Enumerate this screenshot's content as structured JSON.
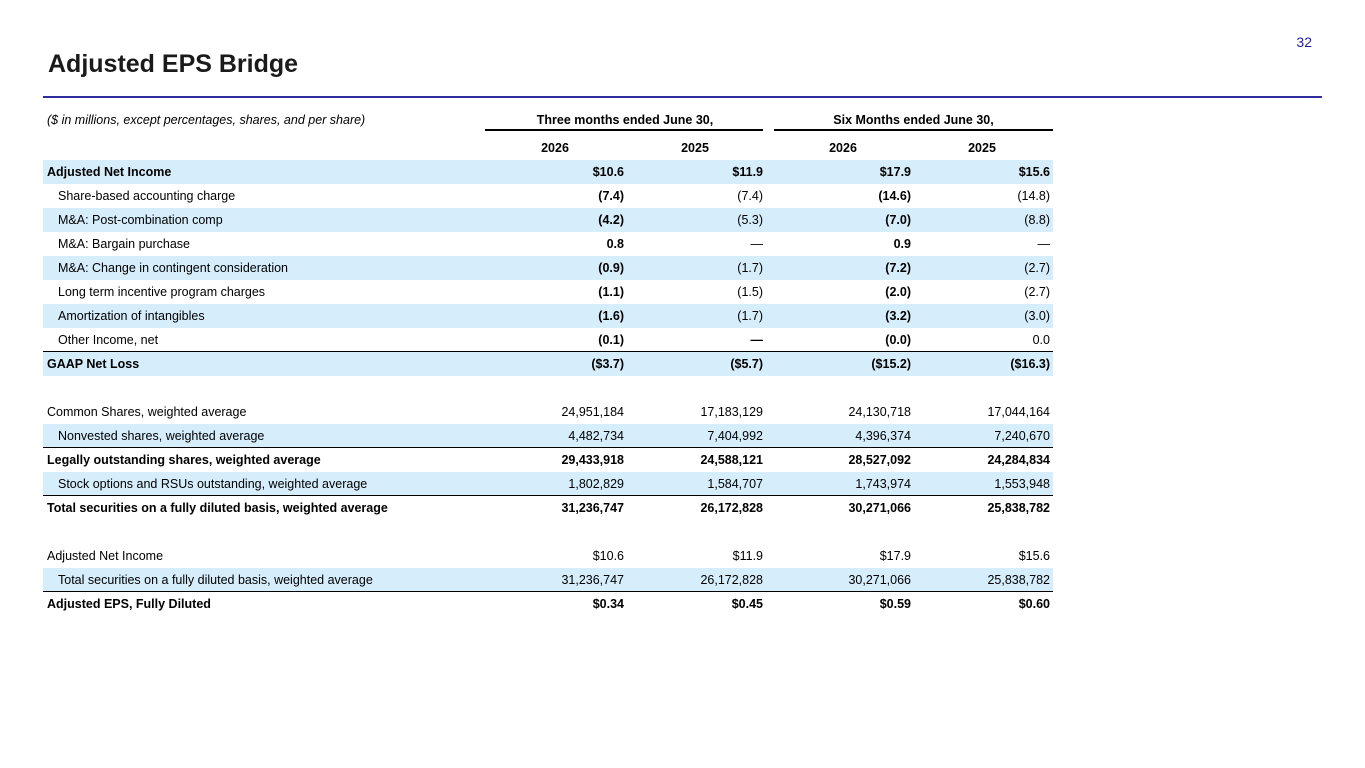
{
  "page": {
    "number": "32",
    "title": "Adjusted EPS Bridge"
  },
  "table": {
    "unit_note": "($ in millions, except percentages, shares, and per share)",
    "groups": [
      "Three months ended June 30,",
      "Six Months ended June 30,"
    ],
    "years": [
      "2026",
      "2025",
      "2026",
      "2025"
    ],
    "rows": [
      {
        "label": "Adjusted Net Income",
        "values": [
          "$10.6",
          "$11.9",
          "$17.9",
          "$15.6"
        ]
      },
      {
        "label": "Share-based accounting charge",
        "values": [
          "(7.4)",
          "(7.4)",
          "(14.6)",
          "(14.8)"
        ]
      },
      {
        "label": "M&A: Post-combination comp",
        "values": [
          "(4.2)",
          "(5.3)",
          "(7.0)",
          "(8.8)"
        ]
      },
      {
        "label": "M&A: Bargain purchase",
        "values": [
          "0.8",
          "—",
          "0.9",
          "—"
        ]
      },
      {
        "label": "M&A: Change in contingent consideration",
        "values": [
          "(0.9)",
          "(1.7)",
          "(7.2)",
          "(2.7)"
        ]
      },
      {
        "label": "Long term incentive program charges",
        "values": [
          "(1.1)",
          "(1.5)",
          "(2.0)",
          "(2.7)"
        ]
      },
      {
        "label": "Amortization of intangibles",
        "values": [
          "(1.6)",
          "(1.7)",
          "(3.2)",
          "(3.0)"
        ]
      },
      {
        "label": "Other Income, net",
        "values": [
          "(0.1)",
          "—",
          "(0.0)",
          "0.0"
        ]
      },
      {
        "label": "GAAP Net Loss",
        "values": [
          "($3.7)",
          "($5.7)",
          "($15.2)",
          "($16.3)"
        ]
      },
      {
        "label": "Common Shares, weighted average",
        "values": [
          "24,951,184",
          "17,183,129",
          "24,130,718",
          "17,044,164"
        ]
      },
      {
        "label": "Nonvested shares, weighted average",
        "values": [
          "4,482,734",
          "7,404,992",
          "4,396,374",
          "7,240,670"
        ]
      },
      {
        "label": "Legally outstanding shares, weighted average",
        "values": [
          "29,433,918",
          "24,588,121",
          "28,527,092",
          "24,284,834"
        ]
      },
      {
        "label": "Stock options and RSUs outstanding, weighted average",
        "values": [
          "1,802,829",
          "1,584,707",
          "1,743,974",
          "1,553,948"
        ]
      },
      {
        "label": "Total securities on a fully diluted basis, weighted average",
        "values": [
          "31,236,747",
          "26,172,828",
          "30,271,066",
          "25,838,782"
        ]
      },
      {
        "label": "Adjusted Net Income",
        "values": [
          "$10.6",
          "$11.9",
          "$17.9",
          "$15.6"
        ]
      },
      {
        "label": "Total securities on a fully diluted basis, weighted average",
        "values": [
          "31,236,747",
          "26,172,828",
          "30,271,066",
          "25,838,782"
        ]
      },
      {
        "label": "Adjusted EPS, Fully Diluted",
        "values": [
          "$0.34",
          "$0.45",
          "$0.59",
          "$0.60"
        ]
      }
    ]
  }
}
